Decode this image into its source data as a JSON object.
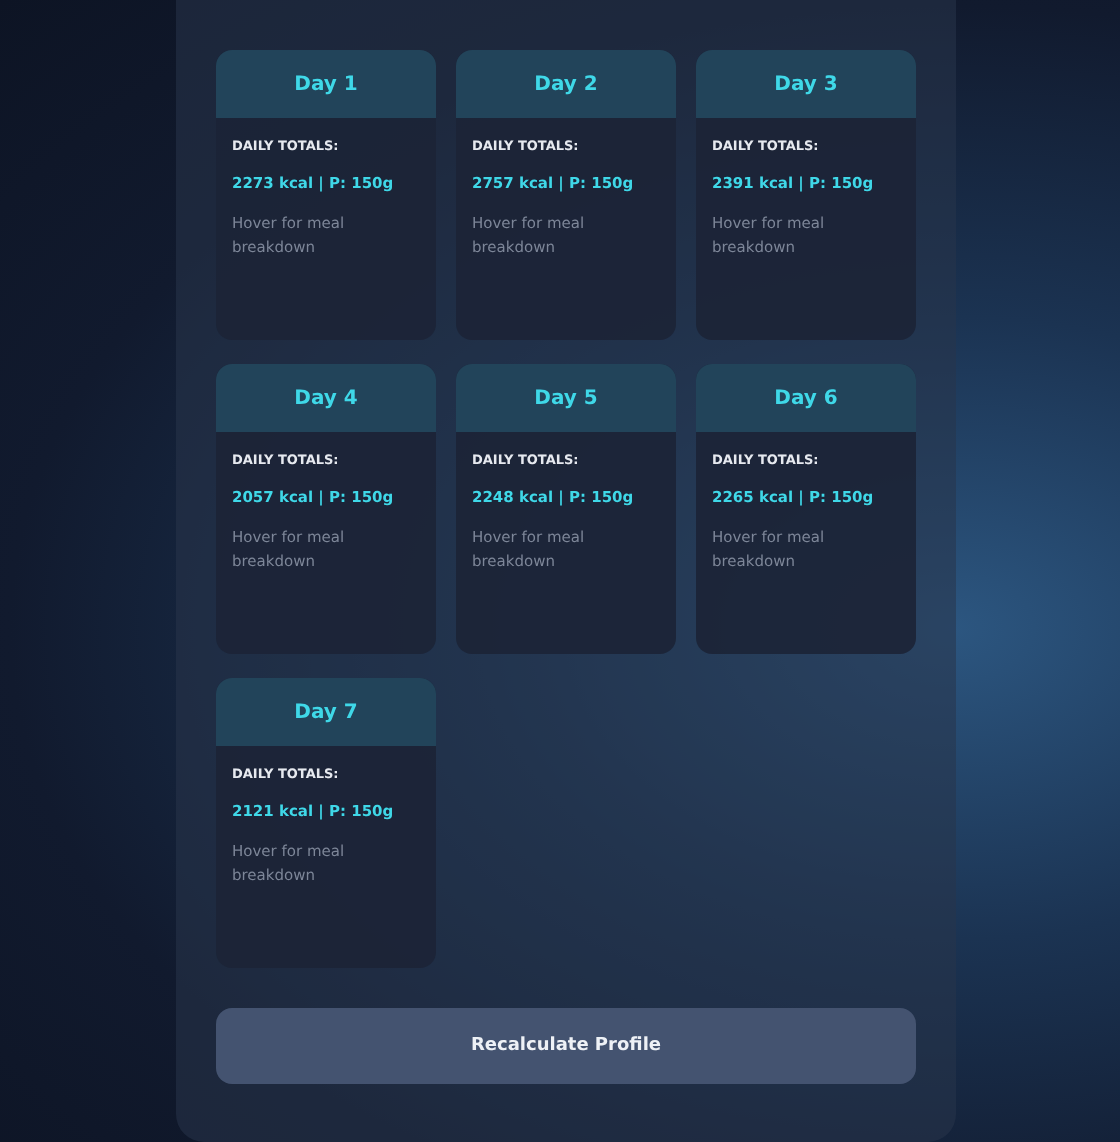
{
  "days": [
    {
      "title": "Day 1",
      "label": "DAILY TOTALS:",
      "totals": "2273 kcal | P: 150g",
      "hint": "Hover for meal breakdown"
    },
    {
      "title": "Day 2",
      "label": "DAILY TOTALS:",
      "totals": "2757 kcal | P: 150g",
      "hint": "Hover for meal breakdown"
    },
    {
      "title": "Day 3",
      "label": "DAILY TOTALS:",
      "totals": "2391 kcal | P: 150g",
      "hint": "Hover for meal breakdown"
    },
    {
      "title": "Day 4",
      "label": "DAILY TOTALS:",
      "totals": "2057 kcal | P: 150g",
      "hint": "Hover for meal breakdown"
    },
    {
      "title": "Day 5",
      "label": "DAILY TOTALS:",
      "totals": "2248 kcal | P: 150g",
      "hint": "Hover for meal breakdown"
    },
    {
      "title": "Day 6",
      "label": "DAILY TOTALS:",
      "totals": "2265 kcal | P: 150g",
      "hint": "Hover for meal breakdown"
    },
    {
      "title": "Day 7",
      "label": "DAILY TOTALS:",
      "totals": "2121 kcal | P: 150g",
      "hint": "Hover for meal breakdown"
    }
  ],
  "button": "Recalculate Profile"
}
